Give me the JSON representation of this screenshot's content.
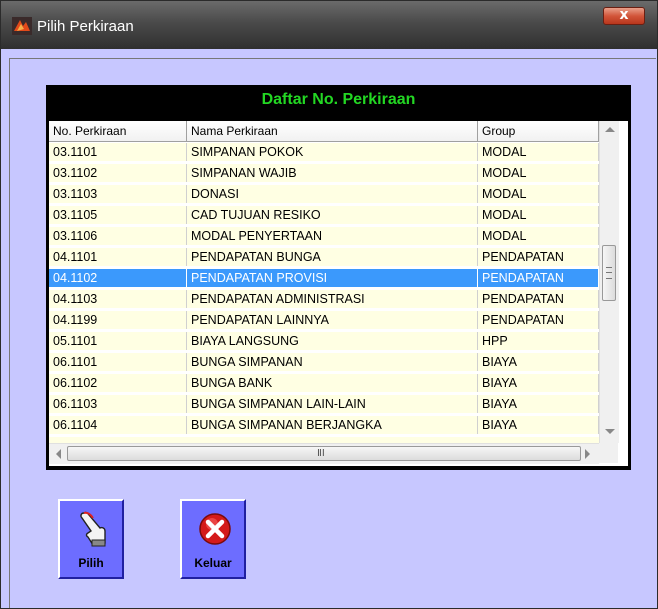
{
  "window": {
    "title": "Pilih Perkiraan",
    "close_glyph": "x"
  },
  "panel": {
    "heading": "Daftar No. Perkiraan"
  },
  "columns": [
    "No. Perkiraan",
    "Nama Perkiraan",
    "Group"
  ],
  "rows": [
    {
      "no": "03.1101",
      "nama": "SIMPANAN POKOK",
      "group": "MODAL"
    },
    {
      "no": "03.1102",
      "nama": "SIMPANAN WAJIB",
      "group": "MODAL"
    },
    {
      "no": "03.1103",
      "nama": "DONASI",
      "group": "MODAL"
    },
    {
      "no": "03.1105",
      "nama": "CAD TUJUAN RESIKO",
      "group": "MODAL"
    },
    {
      "no": "03.1106",
      "nama": "MODAL PENYERTAAN",
      "group": "MODAL"
    },
    {
      "no": "04.1101",
      "nama": "PENDAPATAN BUNGA",
      "group": "PENDAPATAN"
    },
    {
      "no": "04.1102",
      "nama": "PENDAPATAN PROVISI",
      "group": "PENDAPATAN",
      "selected": true
    },
    {
      "no": "04.1103",
      "nama": "PENDAPATAN ADMINISTRASI",
      "group": "PENDAPATAN"
    },
    {
      "no": "04.1199",
      "nama": "PENDAPATAN LAINNYA",
      "group": "PENDAPATAN"
    },
    {
      "no": "05.1101",
      "nama": "BIAYA LANGSUNG",
      "group": "HPP"
    },
    {
      "no": "06.1101",
      "nama": "BUNGA SIMPANAN",
      "group": "BIAYA"
    },
    {
      "no": "06.1102",
      "nama": "BUNGA BANK",
      "group": "BIAYA"
    },
    {
      "no": "06.1103",
      "nama": "BUNGA SIMPANAN LAIN-LAIN",
      "group": "BIAYA"
    },
    {
      "no": "06.1104",
      "nama": "BUNGA SIMPANAN BERJANGKA",
      "group": "BIAYA"
    }
  ],
  "buttons": {
    "pilih": "Pilih",
    "keluar": "Keluar"
  },
  "icons": {
    "app": "app-logo-icon",
    "pilih": "hand-pointer-icon",
    "keluar": "red-x-circle-icon"
  },
  "colors": {
    "window_bg": "#c7c7ff",
    "heading_text": "#23d723",
    "row_bg": "#ffffe3",
    "row_selected_bg": "#3b99fc",
    "button_bg": "#6d6dff",
    "close_bg": "#d2553a"
  }
}
